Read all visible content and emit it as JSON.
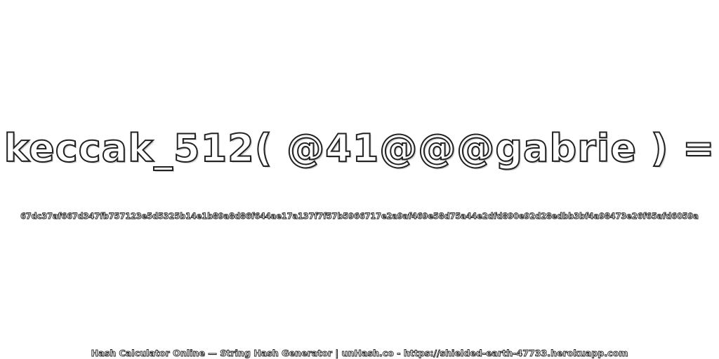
{
  "headline": "keccak_512( @41@@@gabrie ) =",
  "digest": "67dc37af667d347fb757123e5d5325b14e1b89a8d86f644ae17a137f7f57b5966717e2a9af469e58d75a44e2dfd890e92d28edbb3bf4a98473e26f65afd6059a",
  "footer": "Hash Calculator Online — String Hash Generator | unHash.co - https://shielded-earth-47733.herokuapp.com",
  "colors": {
    "text_fill": "#ffffff",
    "text_outline": "#222222",
    "background": "#ffffff"
  }
}
